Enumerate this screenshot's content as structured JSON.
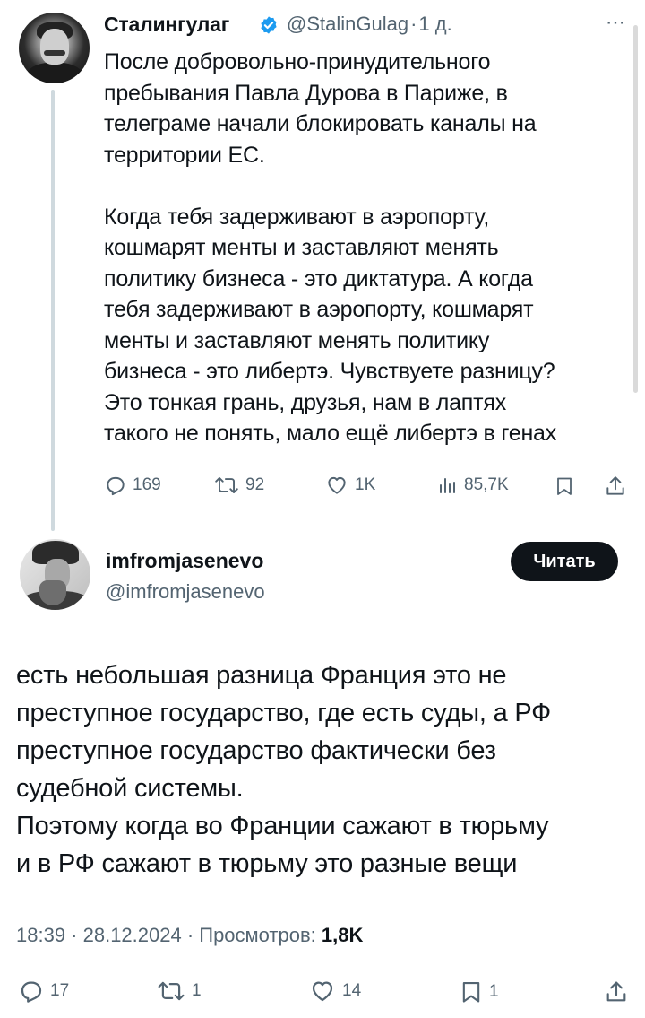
{
  "tweet": {
    "author_name": "Сталингулаг",
    "handle": "@StalinGulag",
    "separator": "·",
    "time": "1 д.",
    "more_icon": "⋯",
    "text": "После добровольно-принудительного\nпребывания Павла Дурова в Париже, в\nтелеграме начали блокировать каналы на\nтерритории ЕС.\n\nКогда тебя задерживают в аэропорту,\nкошмарят менты и заставляют менять\nполитику бизнеса - это диктатура. А когда\nтебя задерживают в аэропорту, кошмарят\nменты и заставляют менять политику\nбизнеса - это либертэ. Чувствуете разницу?\nЭто тонкая грань, друзья, нам в лаптях\nтакого не понять, мало ещё либертэ в генах",
    "stats": {
      "replies": "169",
      "retweets": "92",
      "likes": "1K",
      "views": "85,7K"
    },
    "verified_color": "#1d9bf0"
  },
  "reply": {
    "author_name": "imfromjasenevo",
    "handle": "@imfromjasenevo",
    "follow_label": "Читать",
    "text": "есть небольшая разница Франция это не\nпреступное государство, где есть суды, а РФ\nпреступное государство фактически без\nсудебной системы.\nПоэтому когда во Франции сажают в тюрьму\nи в РФ сажают в тюрьму это разные вещи",
    "timestamp": "18:39 · 28.12.2024 · Просмотров:",
    "views": "1,8K",
    "stats": {
      "replies": "17",
      "retweets": "1",
      "likes": "14",
      "bookmarks": "1"
    }
  },
  "colors": {
    "text": "#0f1419",
    "secondary": "#536471",
    "accent": "#1d9bf0",
    "button_bg": "#0f1419"
  },
  "icons": [
    "reply-icon",
    "retweet-icon",
    "like-icon",
    "views-icon",
    "bookmark-icon",
    "share-icon",
    "verified-icon",
    "more-icon"
  ]
}
